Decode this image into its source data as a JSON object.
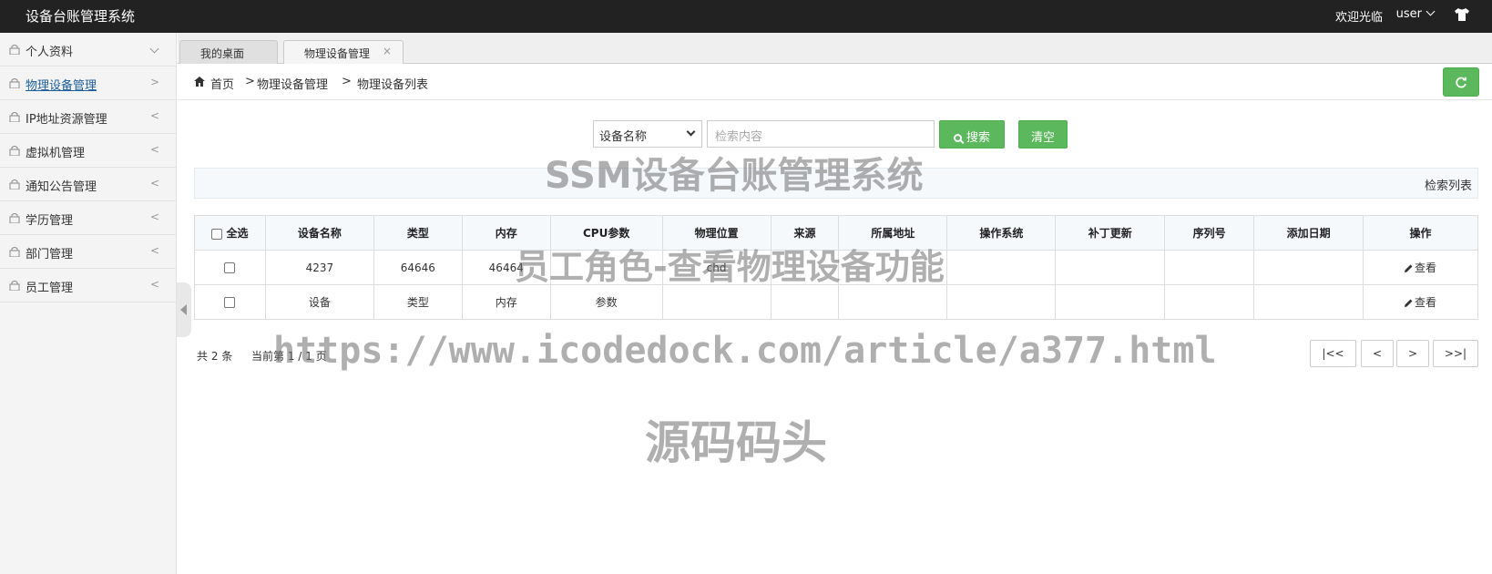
{
  "header": {
    "app_title": "设备台账管理系统",
    "welcome": "欢迎光临",
    "username": "user"
  },
  "sidebar": {
    "items": [
      {
        "label": "个人资料",
        "arrow": ""
      },
      {
        "label": "物理设备管理",
        "arrow": ">"
      },
      {
        "label": "IP地址资源管理",
        "arrow": "<"
      },
      {
        "label": "虚拟机管理",
        "arrow": "<"
      },
      {
        "label": "通知公告管理",
        "arrow": "<"
      },
      {
        "label": "学历管理",
        "arrow": "<"
      },
      {
        "label": "部门管理",
        "arrow": "<"
      },
      {
        "label": "员工管理",
        "arrow": "<"
      }
    ]
  },
  "tabs": [
    {
      "label": "我的桌面"
    },
    {
      "label": "物理设备管理",
      "close": "×"
    }
  ],
  "breadcrumb": {
    "home": "首页",
    "sep": ">",
    "level1": "物理设备管理",
    "level2": "物理设备列表"
  },
  "search": {
    "field_selected": "设备名称",
    "placeholder": "检索内容",
    "search_label": "搜索",
    "clear_label": "清空"
  },
  "panel": {
    "title": "检索列表"
  },
  "table": {
    "select_all": "全选",
    "columns": [
      "设备名称",
      "类型",
      "内存",
      "CPU参数",
      "物理位置",
      "来源",
      "所属地址",
      "操作系统",
      "补丁更新",
      "序列号",
      "添加日期",
      "操作"
    ],
    "rows": [
      {
        "name": "4237",
        "type": "64646",
        "memory": "46464",
        "cpu": "",
        "location": "chd",
        "source": "",
        "address": "",
        "os": "",
        "patch": "",
        "serial": "",
        "date": "",
        "action": "查看"
      },
      {
        "name": "设备",
        "type": "类型",
        "memory": "内存",
        "cpu": "参数",
        "location": "",
        "source": "",
        "address": "",
        "os": "",
        "patch": "",
        "serial": "",
        "date": "",
        "action": "查看"
      }
    ]
  },
  "pagination": {
    "total": "共 2 条",
    "current": "当前第 1 / 1 页",
    "first": "|<<",
    "prev": "<",
    "next": ">",
    "last": ">>|"
  },
  "watermarks": {
    "line1": "SSM设备台账管理系统",
    "line2": "员工角色-查看物理设备功能",
    "line3": "https://www.icodedock.com/article/a377.html",
    "line4": "源码码头"
  },
  "colors": {
    "topbar": "#222222",
    "accent_green": "#5cb85c",
    "active_link": "#1c5e9a"
  }
}
